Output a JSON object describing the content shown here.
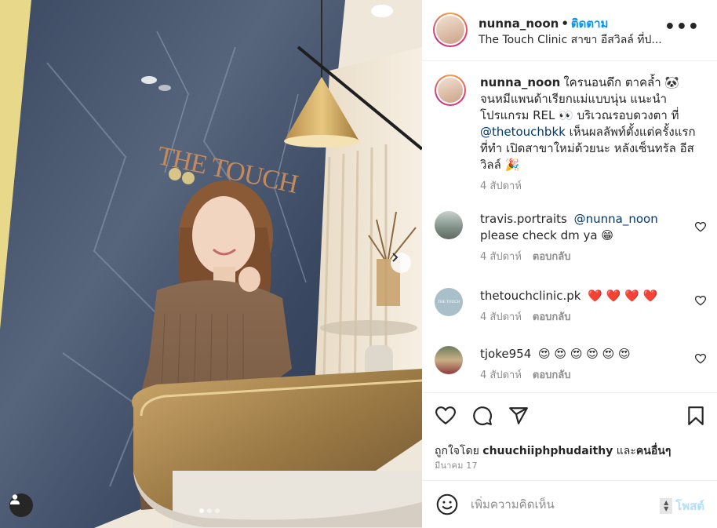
{
  "photo": {
    "sign_text": "THE TOUCH",
    "dots": [
      true,
      false,
      false
    ]
  },
  "header": {
    "username": "nunna_noon",
    "separator": "•",
    "follow_label": "ติดตาม",
    "location": "The Touch Clinic สาขา อีสวิลล์ ที่ป...",
    "more_label": "•••"
  },
  "caption": {
    "username": "nunna_noon",
    "text_before": "ใครนอนดึก ตาคล้ำ 🐼 จนหมีแพนด้าเรียกแม่แบบนุ่น แนะนำโปรแกรม REL 👀 บริเวณรอบดวงตา ที่ ",
    "mention": "@thetouchbkk",
    "text_after": " เห็นผลลัพท์ตั้งแต่ครั้งแรกที่ทำ เปิดสาขาใหม่ด้วยนะ หลังเซ็นทรัล อีสวิลล์ 🎉",
    "time": "4 สัปดาห์"
  },
  "comments": [
    {
      "username": "travis.portraits",
      "mention": "@nunna_noon",
      "text": "please check dm ya 😁",
      "time": "4 สัปดาห์",
      "reply_label": "ตอบกลับ"
    },
    {
      "username": "thetouchclinic.pk",
      "mention": "",
      "text": "❤️ ❤️ ❤️ ❤️",
      "time": "4 สัปดาห์",
      "reply_label": "ตอบกลับ",
      "avatar_text": "THE TOUCH"
    },
    {
      "username": "tjoke954",
      "mention": "",
      "text": "😍 😍 😍 😍 😍 😍",
      "time": "4 สัปดาห์",
      "reply_label": "ตอบกลับ"
    }
  ],
  "actions": {
    "liked_prefix": "ถูกใจโดย ",
    "liked_user": "chuuchiiphphudaithy",
    "liked_and": " และ",
    "liked_others": "คนอื่นๆ",
    "date": "มีนาคม 17"
  },
  "add_comment": {
    "placeholder": "เพิ่มความคิดเห็น",
    "post_label": "โพสต์"
  },
  "colors": {
    "accent": "#0095f6",
    "post_disabled": "#b2dffc",
    "muted": "#8e8e8e"
  }
}
